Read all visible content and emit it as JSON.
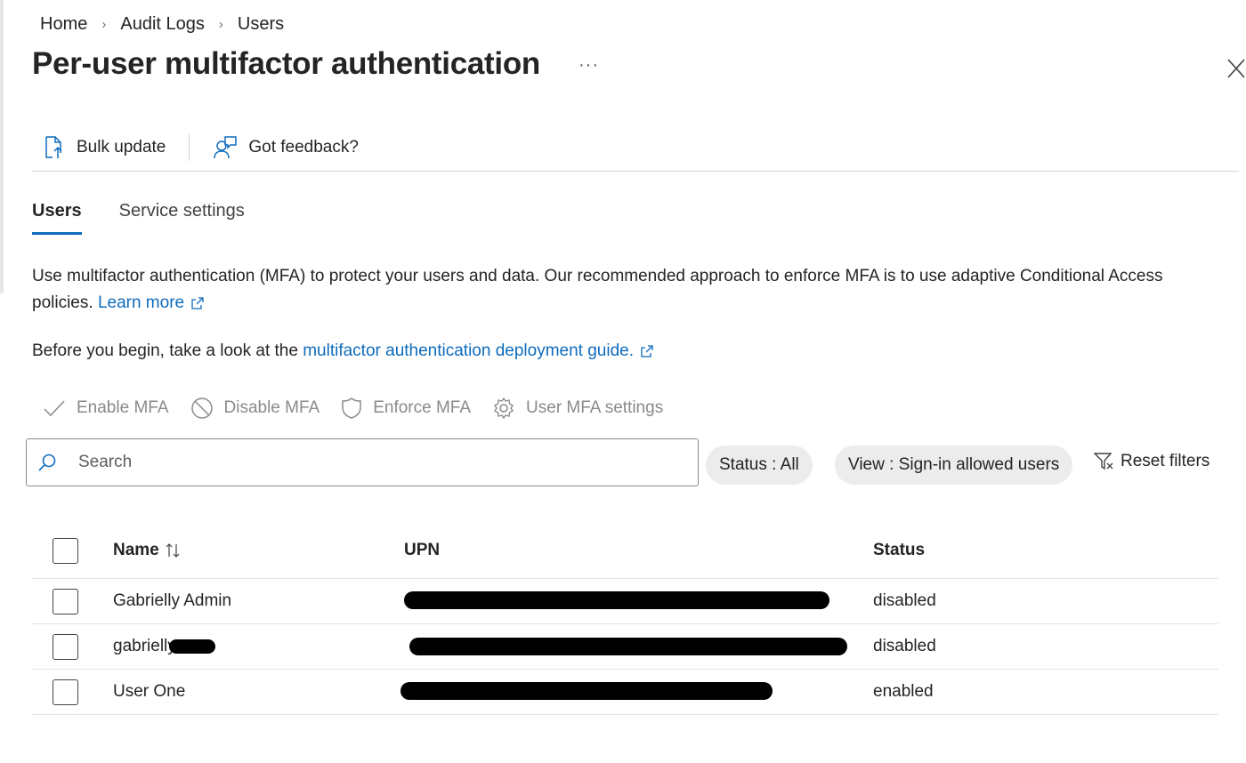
{
  "breadcrumb": [
    "Home",
    "Audit Logs",
    "Users"
  ],
  "page": {
    "title": "Per-user multifactor authentication",
    "more_label": "···"
  },
  "commands": {
    "bulk_update": "Bulk update",
    "feedback": "Got feedback?"
  },
  "tabs": [
    {
      "label": "Users",
      "active": true
    },
    {
      "label": "Service settings",
      "active": false
    }
  ],
  "description": {
    "text": "Use multifactor authentication (MFA) to protect your users and data. Our recommended approach to enforce MFA is to use adaptive Conditional Access policies.",
    "learn_more": "Learn more",
    "guide_prefix": "Before you begin, take a look at the",
    "guide_link": "multifactor authentication deployment guide."
  },
  "actions": {
    "enable": "Enable MFA",
    "disable": "Disable MFA",
    "enforce": "Enforce MFA",
    "settings": "User MFA settings"
  },
  "search": {
    "placeholder": "Search",
    "value": ""
  },
  "filters": {
    "status": "Status : All",
    "view": "View : Sign-in allowed users",
    "reset": "Reset filters"
  },
  "table": {
    "columns": {
      "name": "Name",
      "upn": "UPN",
      "status": "Status"
    },
    "sort_icon": "sort-arrows-icon",
    "rows": [
      {
        "name": "Gabrielly Admin",
        "upn": "",
        "upn_redacted": true,
        "status": "disabled"
      },
      {
        "name": "gabrielly",
        "upn": "",
        "upn_redacted": true,
        "status": "disabled"
      },
      {
        "name": "User One",
        "upn": "",
        "upn_redacted": true,
        "status": "enabled"
      }
    ]
  },
  "colors": {
    "accent": "#0f6cbd",
    "disabled_text": "#8a8a8a",
    "pill_bg": "#ececec"
  }
}
